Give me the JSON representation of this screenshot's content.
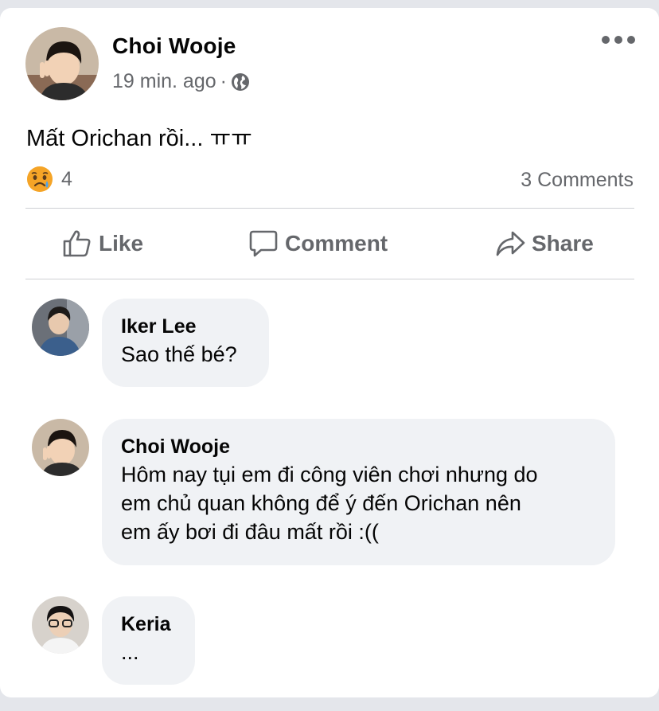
{
  "post": {
    "author": "Choi Wooje",
    "time": "19 min. ago",
    "separator": "·",
    "privacy_icon": "globe-icon",
    "text": "Mất Orichan rồi... ㅠㅠ",
    "reaction_icon": "sad-face-emoji",
    "reaction_count": "4",
    "comments_count": "3 Comments"
  },
  "actions": {
    "like": "Like",
    "comment": "Comment",
    "share": "Share"
  },
  "comments": [
    {
      "author": "Iker Lee",
      "text": "Sao thế bé?"
    },
    {
      "author": "Choi Wooje",
      "text_lines": [
        "Hôm nay tụi em đi công viên chơi nhưng do",
        "em chủ quan không để ý đến Orichan nên",
        "em ấy bơi đi đâu mất rồi :(("
      ]
    },
    {
      "author": "Keria",
      "text": "..."
    }
  ],
  "colors": {
    "page_bg": "#e4e6eb",
    "card_bg": "#ffffff",
    "bubble_bg": "#f0f2f5",
    "secondary_text": "#65676b",
    "primary_text": "#050505"
  }
}
